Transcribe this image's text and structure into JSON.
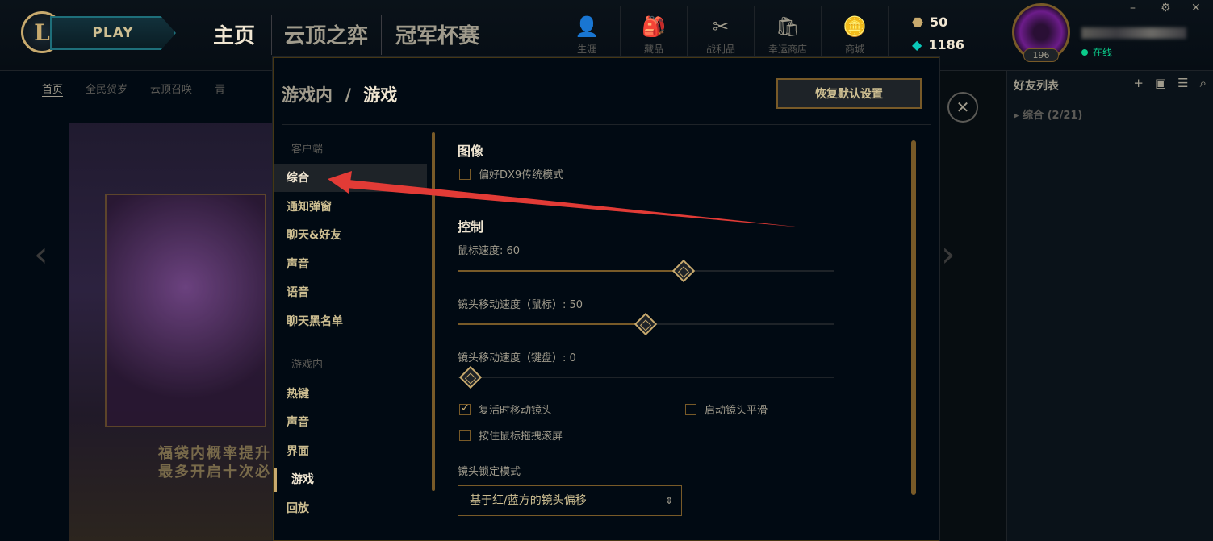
{
  "topbar": {
    "logo_letter": "L",
    "play_label": "PLAY",
    "nav": [
      "主页",
      "云顶之弈",
      "冠军杯赛"
    ],
    "icons": [
      {
        "icon": "profile-icon",
        "glyph": "👤",
        "label": "生涯"
      },
      {
        "icon": "collection-icon",
        "glyph": "🎒",
        "label": "藏品"
      },
      {
        "icon": "loot-icon",
        "glyph": "✂",
        "label": "战利品"
      },
      {
        "icon": "lucky-shop-icon",
        "glyph": "🛍",
        "label": "幸运商店"
      },
      {
        "icon": "store-icon",
        "glyph": "🪙",
        "label": "商城"
      }
    ],
    "orange_essence": "50",
    "blue_essence": "1186",
    "level": "196",
    "status": "在线",
    "window": {
      "minimize": "–",
      "settings": "⚙",
      "close": "✕"
    }
  },
  "subnav": [
    "首页",
    "全民贺岁",
    "云顶召唤",
    "青"
  ],
  "banner": {
    "line1": "福袋内概率提升",
    "line2": "最多开启十次必"
  },
  "friends": {
    "title": "好友列表",
    "actions": [
      "+",
      "▣",
      "☰",
      "⌕"
    ],
    "group": "综合 (2/21)"
  },
  "modal": {
    "breadcrumb_parent": "游戏内",
    "breadcrumb_sep": "/",
    "breadcrumb_current": "游戏",
    "reset_label": "恢复默认设置",
    "close_glyph": "✕",
    "sidebar": {
      "client_header": "客户端",
      "client_items": [
        "综合",
        "通知弹窗",
        "聊天&好友",
        "声音",
        "语音",
        "聊天黑名单"
      ],
      "ingame_header": "游戏内",
      "ingame_items": [
        "热键",
        "声音",
        "界面",
        "游戏",
        "回放"
      ]
    },
    "content": {
      "image_title": "图像",
      "dx9_label": "偏好DX9传统模式",
      "dx9_checked": false,
      "control_title": "控制",
      "mouse_speed_label": "鼠标速度: 60",
      "mouse_speed_value": 60,
      "cam_mouse_label": "镜头移动速度（鼠标）: 50",
      "cam_mouse_value": 50,
      "cam_keyboard_label": "镜头移动速度（键盘）: 0",
      "cam_keyboard_value": 0,
      "respawn_move_label": "复活时移动镜头",
      "respawn_move_checked": true,
      "smooth_cam_label": "启动镜头平滑",
      "smooth_cam_checked": false,
      "drag_scroll_label": "按住鼠标拖拽滚屏",
      "drag_scroll_checked": false,
      "lock_mode_label": "镜头锁定模式",
      "lock_mode_value": "基于红/蓝方的镜头偏移"
    }
  },
  "colors": {
    "accent": "#c8aa6e",
    "annotation": "#e23b36"
  }
}
